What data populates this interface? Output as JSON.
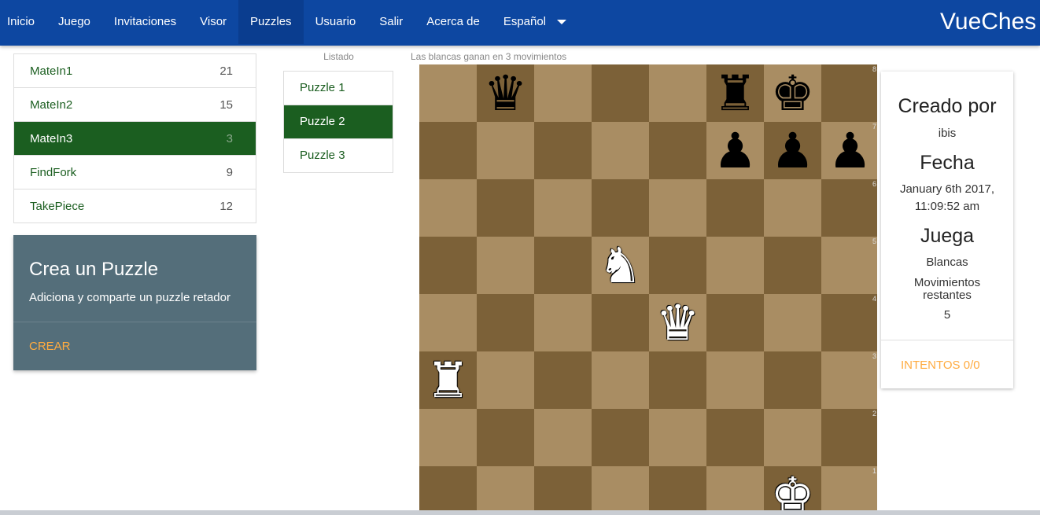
{
  "navbar": {
    "items": [
      "Inicio",
      "Juego",
      "Invitaciones",
      "Visor",
      "Puzzles",
      "Usuario",
      "Salir",
      "Acerca de"
    ],
    "active": "Puzzles",
    "language": "Español",
    "brand": "VueChes"
  },
  "categories": [
    {
      "name": "MateIn1",
      "count": "21"
    },
    {
      "name": "MateIn2",
      "count": "15"
    },
    {
      "name": "MateIn3",
      "count": "3",
      "active": true
    },
    {
      "name": "FindFork",
      "count": "9"
    },
    {
      "name": "TakePiece",
      "count": "12"
    }
  ],
  "create_card": {
    "title": "Crea un Puzzle",
    "description": "Adiciona y comparte un puzzle retador",
    "action": "CREAR"
  },
  "puzzle_list": {
    "header": "Listado",
    "items": [
      "Puzzle 1",
      "Puzzle 2",
      "Puzzle 3"
    ],
    "active_index": 1
  },
  "board": {
    "caption": "Las blancas ganan en 3 movimientos",
    "rank_labels": [
      "8",
      "7",
      "6",
      "5",
      "4",
      "3",
      "2",
      "1"
    ],
    "pieces": [
      {
        "square": "b8",
        "piece": "queen",
        "color": "black",
        "glyph": "♛"
      },
      {
        "square": "f8",
        "piece": "rook",
        "color": "black",
        "glyph": "♜"
      },
      {
        "square": "g8",
        "piece": "king",
        "color": "black",
        "glyph": "♚"
      },
      {
        "square": "f7",
        "piece": "pawn",
        "color": "black",
        "glyph": "♟"
      },
      {
        "square": "g7",
        "piece": "pawn",
        "color": "black",
        "glyph": "♟"
      },
      {
        "square": "h7",
        "piece": "pawn",
        "color": "black",
        "glyph": "♟"
      },
      {
        "square": "d5",
        "piece": "knight",
        "color": "white",
        "glyph": "♞"
      },
      {
        "square": "e4",
        "piece": "queen",
        "color": "white",
        "glyph": "♛"
      },
      {
        "square": "a3",
        "piece": "rook",
        "color": "white",
        "glyph": "♜"
      },
      {
        "square": "g1",
        "piece": "king",
        "color": "white",
        "glyph": "♚"
      }
    ]
  },
  "info": {
    "created_by_label": "Creado por",
    "created_by": "ibis",
    "date_label": "Fecha",
    "date_line1": "January 6th 2017,",
    "date_line2": "11:09:52 am",
    "plays_label": "Juega",
    "plays": "Blancas",
    "moves_label_1": "Movimientos",
    "moves_label_2": "restantes",
    "moves": "5",
    "action": "INTENTOS 0/0"
  },
  "colors": {
    "navbar": "#0d47a1",
    "active_green": "#1b5e20",
    "card_slate": "#546e7a",
    "accent_orange": "#ffab40",
    "board_light": "#a98d63",
    "board_dark": "#7c6138"
  }
}
